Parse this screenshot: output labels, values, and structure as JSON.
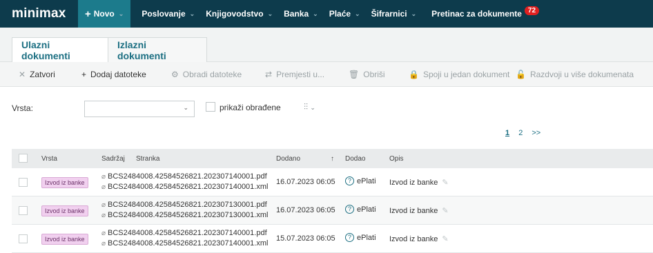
{
  "brand": "minimax",
  "nav": {
    "novo": "Novo",
    "items": [
      "Poslovanje",
      "Knjigovodstvo",
      "Banka",
      "Plaće",
      "Šifrarnici"
    ],
    "inbox_label": "Pretinac za dokumente",
    "inbox_count": "72"
  },
  "tabs": [
    "Ulazni dokumenti",
    "Izlazni dokumenti"
  ],
  "toolbar": {
    "close": "Zatvori",
    "add_files": "Dodaj datoteke",
    "process_files": "Obradi datoteke",
    "move": "Premjesti u...",
    "delete": "Obriši",
    "merge": "Spoji u jedan dokument",
    "split": "Razdvoji u više dokumenata"
  },
  "filter": {
    "label": "Vrsta:",
    "select_value": "",
    "show_processed": "prikaži obrađene"
  },
  "pager": {
    "current": "1",
    "next": "2",
    "more": ">>"
  },
  "table": {
    "headers": {
      "vrsta": "Vrsta",
      "sadrzaj": "Sadržaj",
      "stranka": "Stranka",
      "dodano": "Dodano",
      "dodao": "Dodao",
      "opis": "Opis"
    },
    "rows": [
      {
        "tag": "Izvod iz banke",
        "file1": "BCS2484008.42584526821.202307140001.pdf",
        "file2": "BCS2484008.42584526821.202307140001.xml",
        "date": "16.07.2023 06:05",
        "who": "ePlati",
        "opis": "Izvod iz banke"
      },
      {
        "tag": "Izvod iz banke",
        "file1": "BCS2484008.42584526821.202307130001.pdf",
        "file2": "BCS2484008.42584526821.202307130001.xml",
        "date": "16.07.2023 06:05",
        "who": "ePlati",
        "opis": "Izvod iz banke"
      },
      {
        "tag": "Izvod iz banke",
        "file1": "BCS2484008.42584526821.202307140001.pdf",
        "file2": "BCS2484008.42584526821.202307140001.xml",
        "date": "15.07.2023 06:05",
        "who": "ePlati",
        "opis": "Izvod iz banke"
      }
    ]
  }
}
